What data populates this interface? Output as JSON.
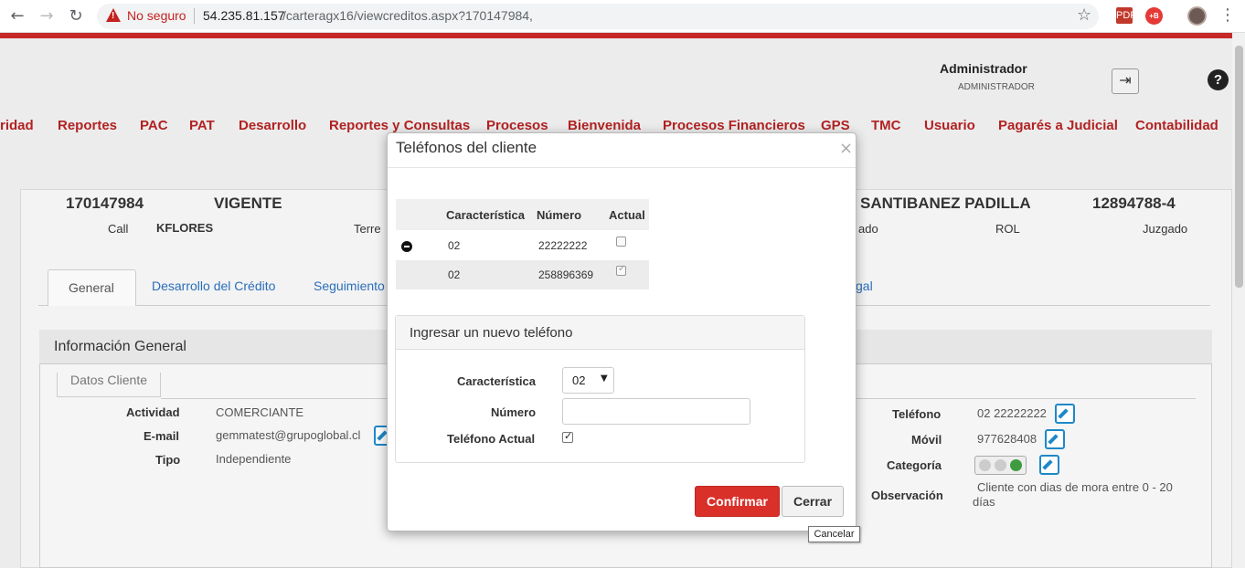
{
  "browser": {
    "security_label": "No seguro",
    "url_host": "54.235.81.157",
    "url_path": "/carteragx16/viewcreditos.aspx?170147984,",
    "back_icon": "arrow-left-icon",
    "forward_icon": "arrow-right-icon",
    "reload_icon": "reload-icon",
    "ext1_label": "PDF",
    "ext2_label": "+B"
  },
  "user": {
    "name": "Administrador",
    "role": "ADMINISTRADOR"
  },
  "menu": [
    "ridad",
    "Reportes",
    "PAC",
    "PAT",
    "Desarrollo",
    "Reportes y Consultas",
    "Procesos",
    "Bienvenida",
    "Procesos Financieros",
    "GPS",
    "TMC",
    "Usuario",
    "Pagarés a Judicial",
    "Contabilidad"
  ],
  "credit": {
    "id": "170147984",
    "status": "VIGENTE",
    "client_name": "SANTIBANEZ PADILLA",
    "rut": "12894788-4",
    "call_label": "Call",
    "call_value": "KFLORES",
    "terr_label": "Terre",
    "ado_label": "ado",
    "rol_label": "ROL",
    "juzgado_label": "Juzgado"
  },
  "tabs": {
    "general": "General",
    "desarrollo": "Desarrollo del Crédito",
    "seguimiento": "Seguimiento",
    "legal": "gal"
  },
  "info": {
    "title": "Información General",
    "legend": "Datos Cliente",
    "actividad_label": "Actividad",
    "actividad_value": "COMERCIANTE",
    "email_label": "E-mail",
    "email_value": "gemmatest@grupoglobal.cl",
    "tipo_label": "Tipo",
    "tipo_value": "Independiente",
    "telefono_label": "Teléfono",
    "telefono_value": "02 22222222",
    "movil_label": "Móvil",
    "movil_value": "977628408",
    "categoria_label": "Categoría",
    "observacion_label": "Observación",
    "observacion_line1": "Cliente con dias de mora entre 0 - 20",
    "observacion_line2": "días"
  },
  "colors": {
    "menu": "#b22222",
    "confirm": "#d9302a",
    "link": "#2a6ebb",
    "status_green": "#3f9b3f"
  },
  "modal": {
    "title": "Teléfonos del cliente",
    "close": "×",
    "table_headers": [
      "Característica",
      "Número",
      "Actual"
    ],
    "rows": [
      {
        "caracteristica": "02",
        "numero": "22222222",
        "actual": false
      },
      {
        "caracteristica": "02",
        "numero": "258896369",
        "actual": true
      }
    ],
    "new_phone_title": "Ingresar un nuevo teléfono",
    "form": {
      "caracteristica_label": "Característica",
      "caracteristica_value": "02",
      "numero_label": "Número",
      "numero_value": "",
      "actual_label": "Teléfono Actual",
      "actual_checked": true
    },
    "confirm_label": "Confirmar",
    "close_label": "Cerrar",
    "tooltip": "Cancelar"
  }
}
